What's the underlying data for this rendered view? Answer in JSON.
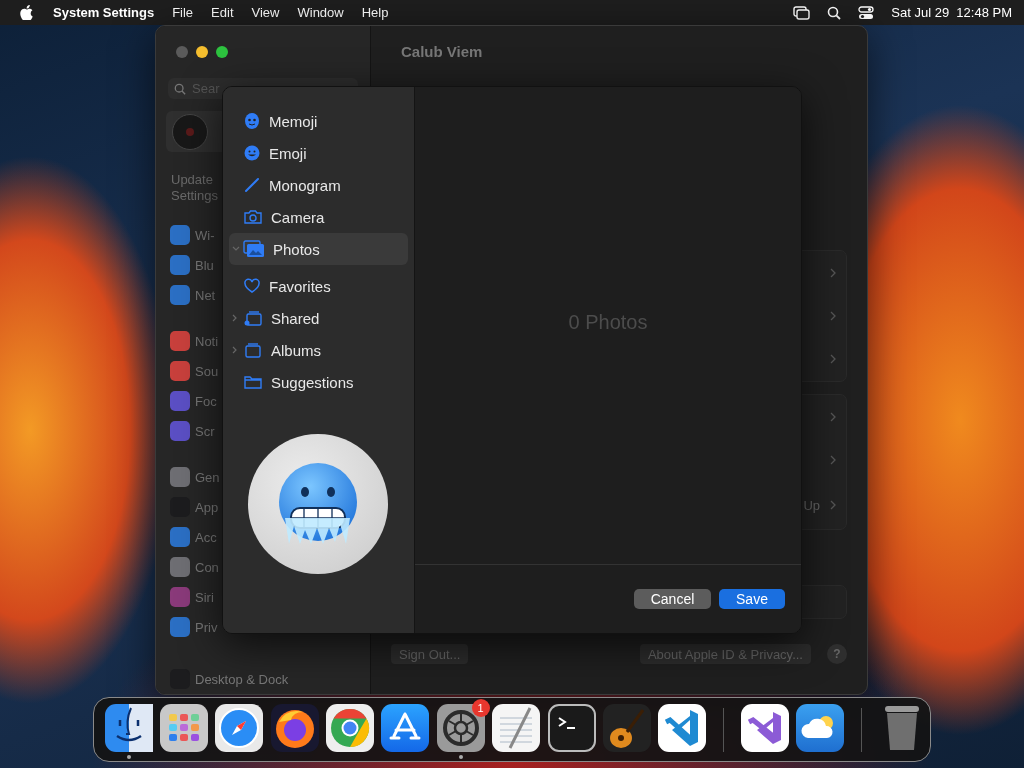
{
  "menu_bar": {
    "app": "System Settings",
    "menus": [
      "File",
      "Edit",
      "View",
      "Window",
      "Help"
    ],
    "clock": "Sat Jul 29  12:48 PM"
  },
  "settings_window": {
    "search": {
      "placeholder": "Sear"
    },
    "update_notice": [
      "Update",
      "Settings"
    ],
    "sections": [
      [
        {
          "label": "Wi-",
          "color": "#2b6fc4"
        },
        {
          "label": "Blu",
          "color": "#2b6fc4"
        },
        {
          "label": "Net",
          "color": "#2b6fc4"
        }
      ],
      [
        {
          "label": "Noti",
          "color": "#c8403c"
        },
        {
          "label": "Sou",
          "color": "#c8403c"
        },
        {
          "label": "Foc",
          "color": "#5b4fc4"
        },
        {
          "label": "Scr",
          "color": "#5b4fc4"
        }
      ],
      [
        {
          "label": "Gen",
          "color": "#6e6e73"
        },
        {
          "label": "App",
          "color": "#1c1c1e"
        },
        {
          "label": "Acc",
          "color": "#2b6fc4"
        },
        {
          "label": "Con",
          "color": "#6e6e73"
        },
        {
          "label": "Siri",
          "color": "#8a3a7a"
        },
        {
          "label": "Priv",
          "color": "#2b6fc4"
        }
      ],
      [
        {
          "label": "Desktop & Dock",
          "color": "#1c1c1e"
        }
      ]
    ],
    "title": "Calub Viem",
    "row_group_text": "Up",
    "sign_out": "Sign Out...",
    "about": "About Apple ID & Privacy...",
    "help": "?"
  },
  "photo_dialog": {
    "sources": [
      {
        "label": "Memoji",
        "selected": false
      },
      {
        "label": "Emoji",
        "selected": false
      },
      {
        "label": "Monogram",
        "selected": false
      },
      {
        "label": "Camera",
        "selected": false
      },
      {
        "label": "Photos",
        "selected": true,
        "expanded": true
      },
      {
        "label": "Favorites",
        "selected": false
      },
      {
        "label": "Shared",
        "selected": false,
        "expanded": false
      },
      {
        "label": "Albums",
        "selected": false,
        "expanded": false
      },
      {
        "label": "Suggestions",
        "selected": false
      }
    ],
    "empty_text": "0 Photos",
    "cancel": "Cancel",
    "save": "Save"
  },
  "dock": {
    "apps": [
      {
        "running": true
      },
      {
        "running": false
      },
      {
        "running": false
      },
      {
        "running": false
      },
      {
        "running": false
      },
      {
        "running": false
      },
      {
        "running": true,
        "badge": "1"
      },
      {
        "running": false
      },
      {
        "running": false
      },
      {
        "running": false
      },
      {
        "running": false
      }
    ],
    "recent_apps": [
      {
        "running": false
      },
      {
        "running": false
      }
    ]
  }
}
